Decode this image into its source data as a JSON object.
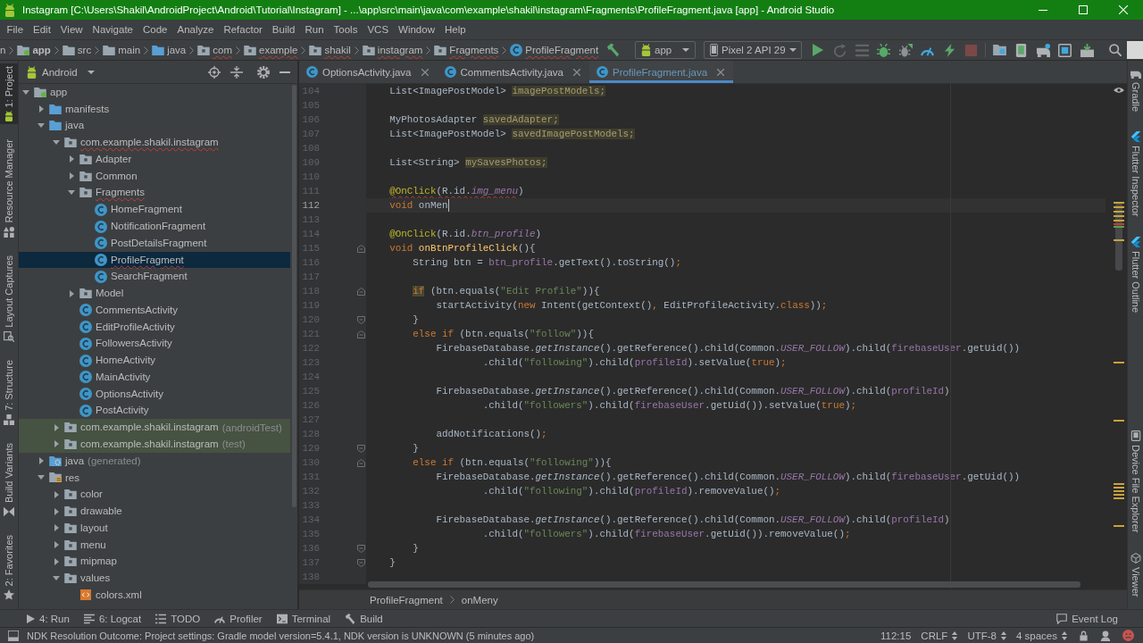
{
  "window": {
    "title": "Instagram [C:\\Users\\Shakil\\AndroidProject\\Android\\Tutorial\\Instagram] - ...\\app\\src\\main\\java\\com\\example\\shakil\\instagram\\Fragments\\ProfileFragment.java [app] - Android Studio"
  },
  "menu": [
    "File",
    "Edit",
    "View",
    "Navigate",
    "Code",
    "Analyze",
    "Refactor",
    "Build",
    "Run",
    "Tools",
    "VCS",
    "Window",
    "Help"
  ],
  "navigation": {
    "crumbs": [
      {
        "label": "n",
        "kind": "cut",
        "error": false
      },
      {
        "label": "app",
        "kind": "module",
        "error": false
      },
      {
        "label": "src",
        "kind": "directory",
        "error": false
      },
      {
        "label": "main",
        "kind": "directory",
        "error": false
      },
      {
        "label": "java",
        "kind": "folder",
        "error": false
      },
      {
        "label": "com",
        "kind": "package",
        "error": true
      },
      {
        "label": "example",
        "kind": "package",
        "error": true
      },
      {
        "label": "shakil",
        "kind": "package",
        "error": true
      },
      {
        "label": "instagram",
        "kind": "package",
        "error": true
      },
      {
        "label": "Fragments",
        "kind": "package",
        "error": true
      },
      {
        "label": "ProfileFragment",
        "kind": "class",
        "error": true
      }
    ],
    "run_configuration": "app",
    "device": "Pixel 2 API 29",
    "actions": [
      {
        "kind": "run",
        "disabled": false
      },
      {
        "kind": "rerun",
        "disabled": true
      },
      {
        "kind": "coverage",
        "disabled": true
      },
      {
        "kind": "debug",
        "disabled": false
      },
      {
        "kind": "attach",
        "disabled": false
      },
      {
        "kind": "profile",
        "disabled": false
      },
      {
        "kind": "apply",
        "disabled": false
      },
      {
        "kind": "stop",
        "disabled": true
      }
    ],
    "tools": [
      {
        "kind": "structure"
      },
      {
        "kind": "avd"
      },
      {
        "kind": "sync"
      },
      {
        "kind": "explorer"
      },
      {
        "kind": "sdk"
      }
    ]
  },
  "left_tool_windows": [
    {
      "label": "1: Project",
      "kind": "android",
      "selected": true
    },
    {
      "label": "Resource Manager",
      "kind": "resources",
      "selected": false
    },
    {
      "label": "Layout Captures",
      "kind": "captures",
      "selected": false
    },
    {
      "label": "7: Structure",
      "kind": "structure",
      "selected": false
    },
    {
      "label": "Build Variants",
      "kind": "variants",
      "selected": false
    },
    {
      "label": "2: Favorites",
      "kind": "favorites",
      "selected": false
    }
  ],
  "project": {
    "view": "Android",
    "tree": [
      {
        "label": "app",
        "kind": "module",
        "expanded": true,
        "selected": false,
        "error": false,
        "children": [
          {
            "label": "manifests",
            "kind": "folder",
            "expanded": false,
            "selected": false,
            "error": false
          },
          {
            "label": "java",
            "kind": "folder",
            "expanded": true,
            "selected": false,
            "error": false,
            "children": [
              {
                "label": "com.example.shakil.instagram",
                "kind": "package",
                "expanded": true,
                "selected": false,
                "error": true,
                "children": [
                  {
                    "label": "Adapter",
                    "kind": "package",
                    "expanded": false,
                    "selected": false,
                    "error": false
                  },
                  {
                    "label": "Common",
                    "kind": "package",
                    "expanded": false,
                    "selected": false,
                    "error": false
                  },
                  {
                    "label": "Fragments",
                    "kind": "package",
                    "expanded": true,
                    "selected": false,
                    "error": true,
                    "children": [
                      {
                        "label": "HomeFragment",
                        "kind": "class",
                        "selected": false,
                        "error": false
                      },
                      {
                        "label": "NotificationFragment",
                        "kind": "class",
                        "selected": false,
                        "error": false
                      },
                      {
                        "label": "PostDetailsFragment",
                        "kind": "class",
                        "selected": false,
                        "error": false
                      },
                      {
                        "label": "ProfileFragment",
                        "kind": "class",
                        "selected": true,
                        "error": true
                      },
                      {
                        "label": "SearchFragment",
                        "kind": "class",
                        "selected": false,
                        "error": false
                      }
                    ]
                  },
                  {
                    "label": "Model",
                    "kind": "package",
                    "expanded": false,
                    "selected": false,
                    "error": false
                  },
                  {
                    "label": "CommentsActivity",
                    "kind": "class",
                    "selected": false,
                    "error": false
                  },
                  {
                    "label": "EditProfileActivity",
                    "kind": "class",
                    "selected": false,
                    "error": false
                  },
                  {
                    "label": "FollowersActivity",
                    "kind": "class",
                    "selected": false,
                    "error": false
                  },
                  {
                    "label": "HomeActivity",
                    "kind": "class",
                    "selected": false,
                    "error": false
                  },
                  {
                    "label": "MainActivity",
                    "kind": "class",
                    "selected": false,
                    "error": false
                  },
                  {
                    "label": "OptionsActivity",
                    "kind": "class",
                    "selected": false,
                    "error": false
                  },
                  {
                    "label": "PostActivity",
                    "kind": "class",
                    "selected": false,
                    "error": false
                  }
                ]
              },
              {
                "label": "com.example.shakil.instagram",
                "note": "(androidTest)",
                "kind": "test_package",
                "expanded": false,
                "selected": false,
                "error": false
              },
              {
                "label": "com.example.shakil.instagram",
                "note": "(test)",
                "kind": "test_package",
                "expanded": false,
                "selected": false,
                "error": false
              }
            ]
          },
          {
            "label": "java",
            "note": "(generated)",
            "kind": "generated",
            "expanded": false,
            "selected": false,
            "error": false
          },
          {
            "label": "res",
            "kind": "resources",
            "expanded": true,
            "selected": false,
            "error": false,
            "children": [
              {
                "label": "color",
                "kind": "res_directory",
                "expanded": false,
                "selected": false,
                "error": false
              },
              {
                "label": "drawable",
                "kind": "res_directory",
                "expanded": false,
                "selected": false,
                "error": false
              },
              {
                "label": "layout",
                "kind": "res_directory",
                "expanded": false,
                "selected": false,
                "error": false
              },
              {
                "label": "menu",
                "kind": "res_directory",
                "expanded": false,
                "selected": false,
                "error": false
              },
              {
                "label": "mipmap",
                "kind": "res_directory",
                "expanded": false,
                "selected": false,
                "error": false
              },
              {
                "label": "values",
                "kind": "res_directory",
                "expanded": true,
                "selected": false,
                "error": false,
                "children": [
                  {
                    "label": "colors.xml",
                    "kind": "xml",
                    "selected": false,
                    "error": false
                  }
                ]
              }
            ]
          }
        ]
      }
    ]
  },
  "editor": {
    "tabs": [
      {
        "label": "OptionsActivity.java",
        "selected": false,
        "modified": false
      },
      {
        "label": "CommentsActivity.java",
        "selected": false,
        "modified": false
      },
      {
        "label": "ProfileFragment.java",
        "selected": true,
        "modified": true
      }
    ],
    "lines": [
      {
        "number": "104",
        "current": false,
        "tokens": [
          {
            "kind": "plain",
            "text": "    List<ImagePostModel> "
          },
          {
            "kind": "unused",
            "text": "imagePostModels;"
          }
        ]
      },
      {
        "number": "105",
        "current": false
      },
      {
        "number": "106",
        "current": false,
        "tokens": [
          {
            "kind": "plain",
            "text": "    MyPhotosAdapter "
          },
          {
            "kind": "unused",
            "text": "savedAdapter;"
          }
        ]
      },
      {
        "number": "107",
        "current": false,
        "tokens": [
          {
            "kind": "plain",
            "text": "    List<ImagePostModel> "
          },
          {
            "kind": "unused",
            "text": "savedImagePostModels;"
          }
        ]
      },
      {
        "number": "108",
        "current": false
      },
      {
        "number": "109",
        "current": false,
        "tokens": [
          {
            "kind": "plain",
            "text": "    List<String> "
          },
          {
            "kind": "unused",
            "text": "mySavesPhotos;"
          }
        ]
      },
      {
        "number": "110",
        "current": false
      },
      {
        "number": "111",
        "current": false,
        "tokens": [
          {
            "kind": "annotation_error",
            "text": "    @OnClick"
          },
          {
            "kind": "plain_error",
            "text": "(R.id."
          },
          {
            "kind": "static_field_error",
            "text": "img_menu"
          },
          {
            "kind": "plain",
            "text": ")"
          }
        ]
      },
      {
        "number": "112",
        "current": true,
        "tokens": [
          {
            "kind": "keyword",
            "text": "    void"
          },
          {
            "kind": "plain",
            "text": " onMen"
          }
        ]
      },
      {
        "number": "113",
        "current": false
      },
      {
        "number": "114",
        "current": false,
        "tokens": [
          {
            "kind": "annotation",
            "text": "    @OnClick"
          },
          {
            "kind": "plain",
            "text": "(R.id."
          },
          {
            "kind": "static_field",
            "text": "btn_profile"
          },
          {
            "kind": "plain",
            "text": ")"
          }
        ]
      },
      {
        "number": "115",
        "current": false,
        "fold_marker": {
          "kind": "start"
        },
        "tokens": [
          {
            "kind": "keyword",
            "text": "    void "
          },
          {
            "kind": "method_decl",
            "text": "onBtnProfileClick"
          },
          {
            "kind": "plain",
            "text": "(){"
          }
        ]
      },
      {
        "number": "116",
        "current": false,
        "tokens": [
          {
            "kind": "plain",
            "text": "        String btn = "
          },
          {
            "kind": "field",
            "text": "btn_profile"
          },
          {
            "kind": "plain",
            "text": ".getText().toString()"
          },
          {
            "kind": "punct",
            "text": ";"
          }
        ]
      },
      {
        "number": "117",
        "current": false
      },
      {
        "number": "118",
        "current": false,
        "fold_marker": {
          "kind": "start"
        },
        "tokens": [
          {
            "kind": "keyword_warning",
            "text": "        if"
          },
          {
            "kind": "plain",
            "text": " (btn.equals("
          },
          {
            "kind": "string",
            "text": "\"Edit Profile\""
          },
          {
            "kind": "plain",
            "text": ")){"
          }
        ]
      },
      {
        "number": "119",
        "current": false,
        "tokens": [
          {
            "kind": "plain",
            "text": "            startActivity("
          },
          {
            "kind": "keyword",
            "text": "new"
          },
          {
            "kind": "plain",
            "text": " Intent(getContext()"
          },
          {
            "kind": "punct",
            "text": ","
          },
          {
            "kind": "plain",
            "text": " EditProfileActivity."
          },
          {
            "kind": "keyword",
            "text": "class"
          },
          {
            "kind": "plain",
            "text": "))"
          },
          {
            "kind": "punct",
            "text": ";"
          }
        ]
      },
      {
        "number": "120",
        "current": false,
        "fold_marker": {
          "kind": "end"
        },
        "tokens": [
          {
            "kind": "plain",
            "text": "        }"
          }
        ]
      },
      {
        "number": "121",
        "current": false,
        "fold_marker": {
          "kind": "start"
        },
        "tokens": [
          {
            "kind": "keyword",
            "text": "        else if"
          },
          {
            "kind": "plain",
            "text": " (btn.equals("
          },
          {
            "kind": "string",
            "text": "\"follow\""
          },
          {
            "kind": "plain",
            "text": ")){"
          }
        ]
      },
      {
        "number": "122",
        "current": false,
        "tokens": [
          {
            "kind": "plain",
            "text": "            FirebaseDatabase."
          },
          {
            "kind": "static_method",
            "text": "getInstance"
          },
          {
            "kind": "plain",
            "text": "().getReference().child(Common."
          },
          {
            "kind": "static_field",
            "text": "USER_FOLLOW"
          },
          {
            "kind": "plain",
            "text": ").child("
          },
          {
            "kind": "field",
            "text": "firebaseUser"
          },
          {
            "kind": "plain",
            "text": ".getUid())"
          }
        ]
      },
      {
        "number": "123",
        "current": false,
        "tokens": [
          {
            "kind": "plain",
            "text": "                    .child("
          },
          {
            "kind": "string",
            "text": "\"following\""
          },
          {
            "kind": "plain",
            "text": ").child("
          },
          {
            "kind": "field",
            "text": "profileId"
          },
          {
            "kind": "plain",
            "text": ").setValue("
          },
          {
            "kind": "keyword",
            "text": "true"
          },
          {
            "kind": "plain",
            "text": ")"
          },
          {
            "kind": "punct",
            "text": ";"
          }
        ]
      },
      {
        "number": "124",
        "current": false
      },
      {
        "number": "125",
        "current": false,
        "tokens": [
          {
            "kind": "plain",
            "text": "            FirebaseDatabase."
          },
          {
            "kind": "static_method",
            "text": "getInstance"
          },
          {
            "kind": "plain",
            "text": "().getReference().child(Common."
          },
          {
            "kind": "static_field",
            "text": "USER_FOLLOW"
          },
          {
            "kind": "plain",
            "text": ").child("
          },
          {
            "kind": "field",
            "text": "profileId"
          },
          {
            "kind": "plain",
            "text": ")"
          }
        ]
      },
      {
        "number": "126",
        "current": false,
        "tokens": [
          {
            "kind": "plain",
            "text": "                    .child("
          },
          {
            "kind": "string",
            "text": "\"followers\""
          },
          {
            "kind": "plain",
            "text": ").child("
          },
          {
            "kind": "field",
            "text": "firebaseUser"
          },
          {
            "kind": "plain",
            "text": ".getUid()).setValue("
          },
          {
            "kind": "keyword",
            "text": "true"
          },
          {
            "kind": "plain",
            "text": ")"
          },
          {
            "kind": "punct",
            "text": ";"
          }
        ]
      },
      {
        "number": "127",
        "current": false
      },
      {
        "number": "128",
        "current": false,
        "tokens": [
          {
            "kind": "plain",
            "text": "            addNotifications()"
          },
          {
            "kind": "punct",
            "text": ";"
          }
        ]
      },
      {
        "number": "129",
        "current": false,
        "fold_marker": {
          "kind": "end"
        },
        "tokens": [
          {
            "kind": "plain",
            "text": "        }"
          }
        ]
      },
      {
        "number": "130",
        "current": false,
        "fold_marker": {
          "kind": "start"
        },
        "tokens": [
          {
            "kind": "keyword",
            "text": "        else if"
          },
          {
            "kind": "plain",
            "text": " (btn.equals("
          },
          {
            "kind": "string",
            "text": "\"following\""
          },
          {
            "kind": "plain",
            "text": ")){"
          }
        ]
      },
      {
        "number": "131",
        "current": false,
        "tokens": [
          {
            "kind": "plain",
            "text": "            FirebaseDatabase."
          },
          {
            "kind": "static_method",
            "text": "getInstance"
          },
          {
            "kind": "plain",
            "text": "().getReference().child(Common."
          },
          {
            "kind": "static_field",
            "text": "USER_FOLLOW"
          },
          {
            "kind": "plain",
            "text": ").child("
          },
          {
            "kind": "field",
            "text": "firebaseUser"
          },
          {
            "kind": "plain",
            "text": ".getUid())"
          }
        ]
      },
      {
        "number": "132",
        "current": false,
        "tokens": [
          {
            "kind": "plain",
            "text": "                    .child("
          },
          {
            "kind": "string",
            "text": "\"following\""
          },
          {
            "kind": "plain",
            "text": ").child("
          },
          {
            "kind": "field",
            "text": "profileId"
          },
          {
            "kind": "plain",
            "text": ").removeValue()"
          },
          {
            "kind": "punct",
            "text": ";"
          }
        ]
      },
      {
        "number": "133",
        "current": false
      },
      {
        "number": "134",
        "current": false,
        "tokens": [
          {
            "kind": "plain",
            "text": "            FirebaseDatabase."
          },
          {
            "kind": "static_method",
            "text": "getInstance"
          },
          {
            "kind": "plain",
            "text": "().getReference().child(Common."
          },
          {
            "kind": "static_field",
            "text": "USER_FOLLOW"
          },
          {
            "kind": "plain",
            "text": ").child("
          },
          {
            "kind": "field",
            "text": "profileId"
          },
          {
            "kind": "plain",
            "text": ")"
          }
        ]
      },
      {
        "number": "135",
        "current": false,
        "tokens": [
          {
            "kind": "plain",
            "text": "                    .child("
          },
          {
            "kind": "string",
            "text": "\"followers\""
          },
          {
            "kind": "plain",
            "text": ").child("
          },
          {
            "kind": "field",
            "text": "firebaseUser"
          },
          {
            "kind": "plain",
            "text": ".getUid()).removeValue()"
          },
          {
            "kind": "punct",
            "text": ";"
          }
        ]
      },
      {
        "number": "136",
        "current": false,
        "fold_marker": {
          "kind": "end"
        },
        "tokens": [
          {
            "kind": "plain",
            "text": "        }"
          }
        ]
      },
      {
        "number": "137",
        "current": false,
        "fold_marker": {
          "kind": "end"
        },
        "tokens": [
          {
            "kind": "plain",
            "text": "    }"
          }
        ]
      },
      {
        "number": "138",
        "current": false
      }
    ],
    "breadcrumb": [
      "ProfileFragment",
      "onMeny"
    ]
  },
  "right_tool_windows": {
    "top": [
      {
        "label": "Gradle",
        "kind": "gradle",
        "selected": false
      },
      {
        "label": "Flutter Inspector",
        "kind": "flutter",
        "selected": false
      },
      {
        "label": "Flutter Outline",
        "kind": "flutter",
        "selected": false
      }
    ],
    "bottom": [
      {
        "label": "Device File Explorer",
        "kind": "device",
        "selected": false
      },
      {
        "label": "Viewer",
        "kind": "viewer",
        "selected": false
      }
    ]
  },
  "bottom_tool_windows": [
    {
      "label": "4: Run",
      "kind": "run",
      "selected": false
    },
    {
      "label": "6: Logcat",
      "kind": "logcat",
      "selected": false
    },
    {
      "label": "TODO",
      "kind": "todo",
      "selected": false
    },
    {
      "label": "Profiler",
      "kind": "profiler",
      "selected": false
    },
    {
      "label": "Terminal",
      "kind": "terminal",
      "selected": false
    },
    {
      "label": "Build",
      "kind": "build",
      "selected": false
    }
  ],
  "event_log": "Event Log",
  "status_bar": {
    "message": "NDK Resolution Outcome: Project settings: Gradle model version=5.4.1, NDK version is UNKNOWN (5 minutes ago)",
    "position": "112:15",
    "line_separator": "CRLF",
    "encoding": "UTF-8",
    "indent": "4 spaces"
  }
}
